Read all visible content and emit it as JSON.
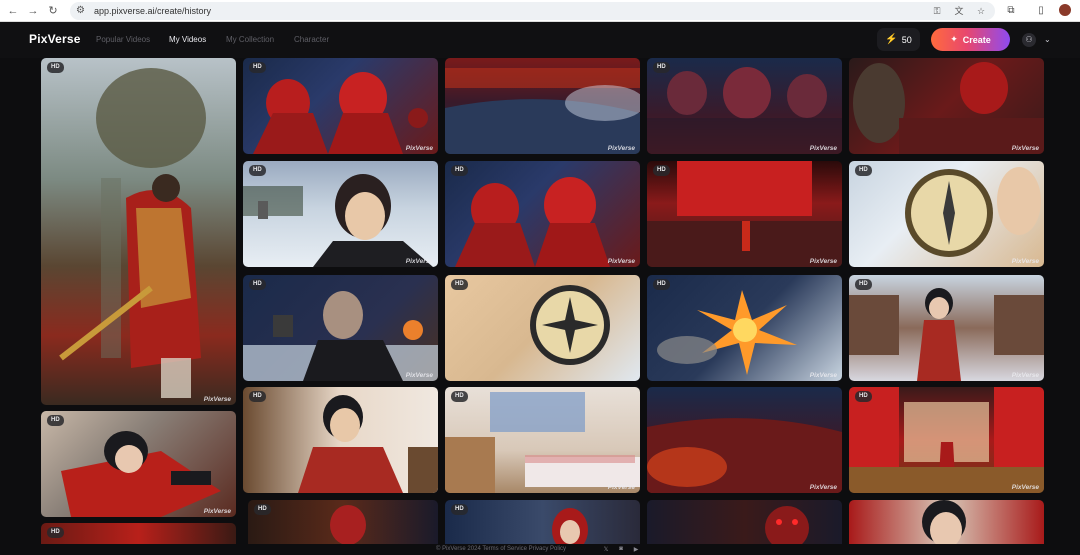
{
  "browser": {
    "url": "app.pixverse.ai/create/history",
    "icons": [
      "back-icon",
      "forward-icon",
      "reload-icon",
      "site-settings-icon",
      "key-icon",
      "translate-icon",
      "star-icon",
      "extensions-icon",
      "sidepanel-icon"
    ]
  },
  "header": {
    "logo": "PixVerse",
    "nav": [
      {
        "label": "Popular Videos",
        "active": false
      },
      {
        "label": "My Videos",
        "active": true
      },
      {
        "label": "My Collection",
        "active": false
      },
      {
        "label": "Character",
        "active": false
      }
    ],
    "credits": "50",
    "create_label": "Create",
    "colors": {
      "accent_start": "#ff6a3d",
      "accent_mid": "#e8476e",
      "accent_end": "#8e4bf0",
      "credit_icon": "#ffb400"
    }
  },
  "gallery": {
    "badge": "HD",
    "watermark": "PixVerse",
    "items": [
      {
        "subject": "golden-armored-warrior-giant",
        "badge": true,
        "watermark": true
      },
      {
        "subject": "red-demons-in-snow",
        "badge": true,
        "watermark": true
      },
      {
        "subject": "theater-audience-fog",
        "badge": false,
        "watermark": true
      },
      {
        "subject": "demons-in-theater",
        "badge": true,
        "watermark": true
      },
      {
        "subject": "demons-in-theater-seats",
        "badge": false,
        "watermark": true
      },
      {
        "subject": "smiling-man-in-snow",
        "badge": true,
        "watermark": true
      },
      {
        "subject": "red-demons-in-snow",
        "badge": true,
        "watermark": true
      },
      {
        "subject": "red-stage-curtain",
        "badge": true,
        "watermark": true
      },
      {
        "subject": "compass-in-hand-snow",
        "badge": true,
        "watermark": true
      },
      {
        "subject": "old-man-at-night-fire",
        "badge": true,
        "watermark": true
      },
      {
        "subject": "compass-close-up",
        "badge": true,
        "watermark": false
      },
      {
        "subject": "compass-explosion",
        "badge": true,
        "watermark": true
      },
      {
        "subject": "young-man-snowy-street",
        "badge": true,
        "watermark": true
      },
      {
        "subject": "young-man-red-robe-falling",
        "badge": true,
        "watermark": true
      },
      {
        "subject": "young-man-red-robe-room",
        "badge": true,
        "watermark": false
      },
      {
        "subject": "bedroom-with-posters",
        "badge": true,
        "watermark": true
      },
      {
        "subject": "fiery-theater-audience",
        "badge": false,
        "watermark": true
      },
      {
        "subject": "figure-on-red-stage",
        "badge": true,
        "watermark": true
      },
      {
        "subject": "partial-red-scene",
        "badge": true,
        "watermark": false
      },
      {
        "subject": "partial-man-dark",
        "badge": true,
        "watermark": false
      },
      {
        "subject": "partial-hooded-girl-street",
        "badge": true,
        "watermark": false
      },
      {
        "subject": "partial-demons-red-eyes",
        "badge": false,
        "watermark": false
      },
      {
        "subject": "partial-angry-young-man",
        "badge": false,
        "watermark": false
      }
    ]
  },
  "footer": {
    "text": "© PixVerse 2024   Terms of Service   Privacy Policy",
    "icons": [
      "x-social-icon",
      "discord-icon",
      "youtube-icon"
    ]
  }
}
